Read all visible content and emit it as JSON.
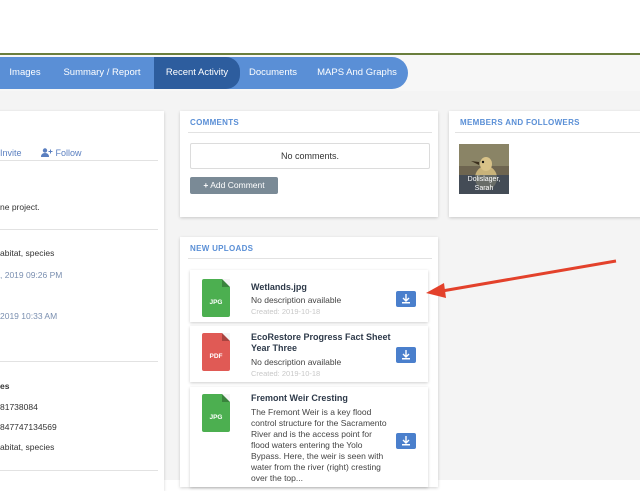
{
  "nav": {
    "tabs": [
      {
        "label": "Images",
        "active": false
      },
      {
        "label": "Summary / Report",
        "active": false
      },
      {
        "label": "Recent Activity",
        "active": true
      },
      {
        "label": "Documents",
        "active": false
      },
      {
        "label": "MAPS And Graphs",
        "active": false
      }
    ]
  },
  "left_panel": {
    "invite_label": "Invite",
    "follow_label": "Follow",
    "project_text": "ne project.",
    "tags_1": "abitat, species",
    "date_1": ", 2019 09:26 PM",
    "date_2": "2019 10:33 AM",
    "section_label": "es",
    "id_1": "81738084",
    "id_2": "847747134569",
    "tags_2": "abitat, species"
  },
  "comments": {
    "title": "COMMENTS",
    "empty_text": "No comments.",
    "add_label": "Add Comment"
  },
  "members": {
    "title": "MEMBERS AND FOLLOWERS",
    "member_name": "Dolislager, Sarah"
  },
  "uploads": {
    "title": "NEW UPLOADS",
    "items": [
      {
        "type": "JPG",
        "color": "#4caf50",
        "title": "Wetlands.jpg",
        "desc": "No description available",
        "created": "Created: 2019-10-18"
      },
      {
        "type": "PDF",
        "color": "#e05a55",
        "title": "EcoRestore Progress Fact Sheet Year Three",
        "desc": "No description available",
        "created": "Created: 2019-10-18"
      },
      {
        "type": "JPG",
        "color": "#4caf50",
        "title": "Fremont Weir Cresting",
        "desc": "The Fremont Weir is a key flood control structure for the Sacramento River and is the access point for flood waters entering the Yolo Bypass. Here, the weir is seen with water from the river (right) cresting over the top...",
        "created": ""
      }
    ]
  },
  "colors": {
    "accent": "#5a8fd6",
    "active_tab": "#2d5d9e",
    "download_button": "#4a7fcc",
    "annotation_arrow": "#e3412b"
  }
}
